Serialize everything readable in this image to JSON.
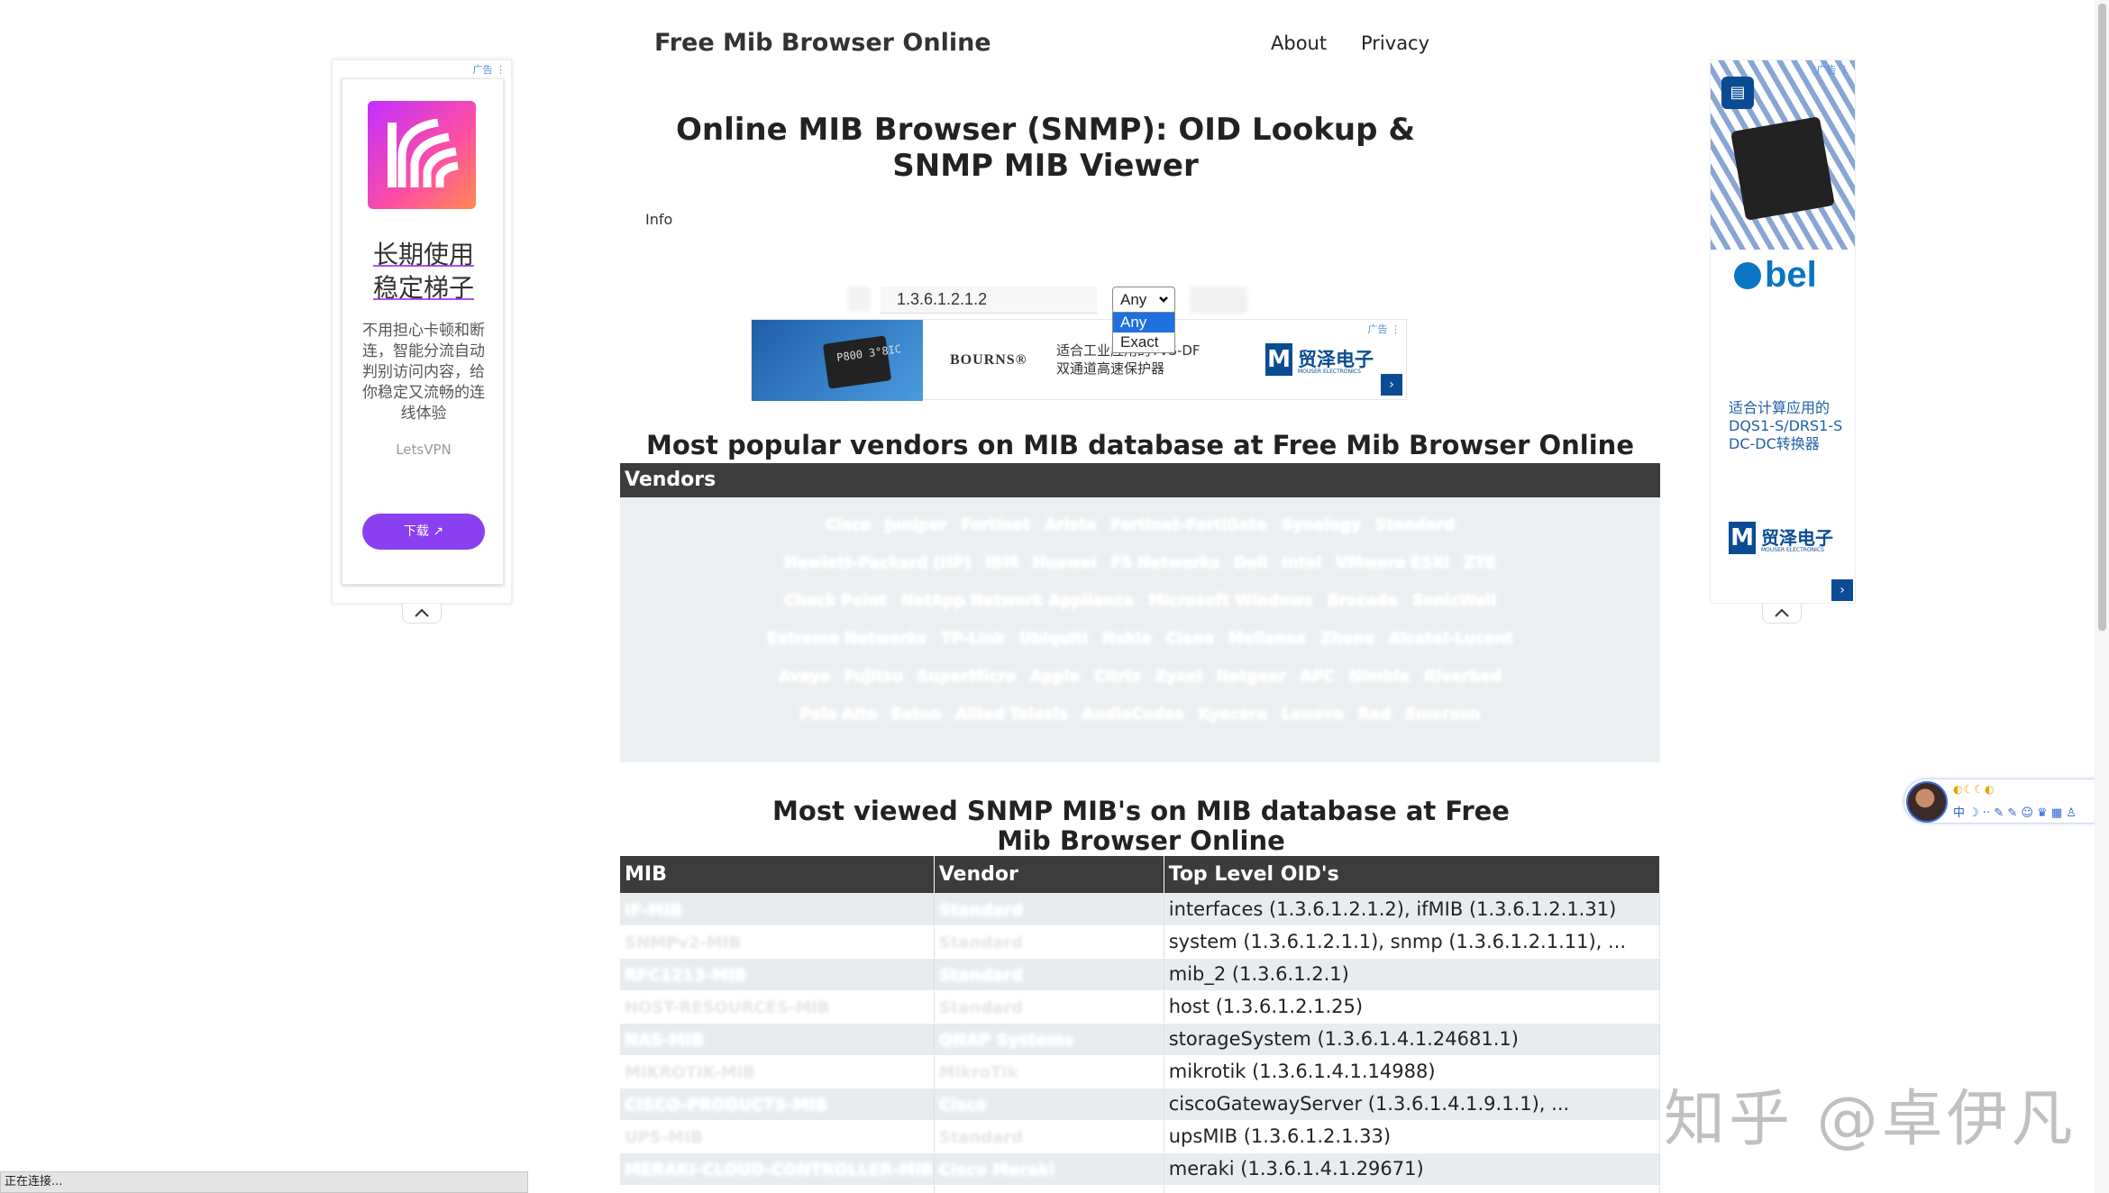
{
  "header": {
    "site_title": "Free Mib Browser Online",
    "nav": [
      {
        "label": "About"
      },
      {
        "label": "Privacy"
      }
    ]
  },
  "page_title": "Online MIB Browser (SNMP): OID Lookup & SNMP MIB Viewer",
  "info_label": "Info",
  "search": {
    "value": "1.3.6.1.2.1.2",
    "match_selected": "Any",
    "match_options": [
      "Any",
      "Exact"
    ]
  },
  "inline_ad": {
    "ad_tag": "广告 ⋮",
    "chip_text": "P800\n3°8IC",
    "brand": "BOURNS®",
    "text": "适合工业应用的TVS-DF\n双通道高速保护器",
    "distributor": "贸泽电子",
    "distributor_sub": "MOUSER ELECTRONICS"
  },
  "vendors_section": {
    "title": "Most popular vendors on MIB database at Free Mib Browser Online",
    "header": "Vendors",
    "items": [
      "Cisco",
      "Juniper",
      "Fortinet",
      "Arista",
      "Fortinet-FortiGate",
      "Synology",
      "Standard",
      "Hewlett-Packard (HP)",
      "IBM",
      "Huawei",
      "F5 Networks",
      "Dell",
      "Intel",
      "VMware ESXi",
      "ZTE",
      "Check Point",
      "NetApp Network Appliance",
      "Microsoft Windows",
      "Brocade",
      "SonicWall",
      "Extreme Networks",
      "TP-Link",
      "Ubiquiti",
      "Nokia",
      "Ciena",
      "Mellanox",
      "Zhone",
      "Alcatel-Lucent",
      "Avaya",
      "Fujitsu",
      "SuperMicro",
      "Apple",
      "Citrix",
      "Zyxel",
      "Netgear",
      "APC",
      "Nimble",
      "Riverbed",
      "Palo Alto",
      "Eaton",
      "Allied Telesis",
      "AudioCodes",
      "Kyocera",
      "Lenovo",
      "Rad",
      "Emerson"
    ]
  },
  "mibs_section": {
    "title": "Most viewed SNMP MIB's on MIB database at Free Mib Browser Online",
    "columns": [
      "MIB",
      "Vendor",
      "Top Level OID's"
    ],
    "rows": [
      {
        "mib": "IF-MIB",
        "vendor": "Standard",
        "oids": "interfaces (1.3.6.1.2.1.2), ifMIB (1.3.6.1.2.1.31)"
      },
      {
        "mib": "SNMPv2-MIB",
        "vendor": "Standard",
        "oids": "system (1.3.6.1.2.1.1), snmp (1.3.6.1.2.1.11), ..."
      },
      {
        "mib": "RFC1213-MIB",
        "vendor": "Standard",
        "oids": "mib_2 (1.3.6.1.2.1)"
      },
      {
        "mib": "HOST-RESOURCES-MIB",
        "vendor": "Standard",
        "oids": "host (1.3.6.1.2.1.25)"
      },
      {
        "mib": "NAS-MIB",
        "vendor": "QNAP Systems",
        "oids": "storageSystem (1.3.6.1.4.1.24681.1)"
      },
      {
        "mib": "MIKROTIK-MIB",
        "vendor": "MikroTik",
        "oids": "mikrotik (1.3.6.1.4.1.14988)"
      },
      {
        "mib": "CISCO-PRODUCTS-MIB",
        "vendor": "Cisco",
        "oids": "ciscoGatewayServer (1.3.6.1.4.1.9.1.1), ..."
      },
      {
        "mib": "UPS-MIB",
        "vendor": "Standard",
        "oids": "upsMIB (1.3.6.1.2.1.33)"
      },
      {
        "mib": "MERAKI-CLOUD-CONTROLLER-MIB",
        "vendor": "Cisco Meraki",
        "oids": "meraki (1.3.6.1.4.1.29671)"
      },
      {
        "mib": "",
        "vendor": "",
        "oids": ""
      }
    ]
  },
  "left_ad": {
    "ad_tag": "广告 ⋮",
    "title_line1": "长期使用",
    "title_line2": "稳定梯子",
    "description": "不用担心卡顿和断连，智能分流自动判别访问内容，给你稳定又流畅的连线体验",
    "brand": "LetsVPN",
    "button_label": "下载 ↗"
  },
  "right_ad": {
    "ad_tag": "广告 ⋮",
    "brand": "bel",
    "text": "适合计算应用的DQS1-S/DRS1-S DC-DC转换器",
    "distributor": "贸泽电子",
    "distributor_sub": "MOUSER ELECTRONICS"
  },
  "float_widget": {
    "top_text": "◐☾☾◐",
    "icons": "中 ☽ ·· ✎ ✎ ☺ ♛ ▦ ♙"
  },
  "status_bar": {
    "text": "正在连接..."
  },
  "watermark": "知乎 @卓伊凡",
  "colors": {
    "table_header": "#3c3c3c",
    "row_stripe": "#e9ecee",
    "vpn_button": "#8a3ff0",
    "mouser_blue": "#0a4c93",
    "select_highlight": "#1e70e0"
  }
}
